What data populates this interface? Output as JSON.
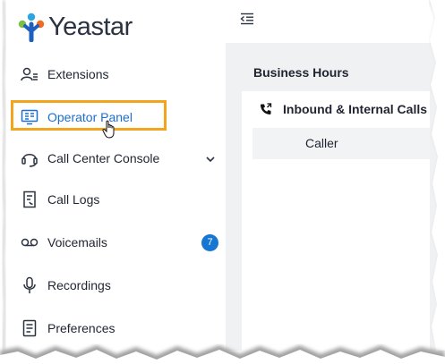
{
  "brand": {
    "name": "Yeastar",
    "logo_colors": [
      "#2aa7e1",
      "#f26b21",
      "#7bc142",
      "#1f5fbf"
    ]
  },
  "sidebar": {
    "items": [
      {
        "label": "Extensions",
        "icon": "extensions-icon"
      },
      {
        "label": "Operator Panel",
        "icon": "operator-panel-icon",
        "active": true
      },
      {
        "label": "Call Center Console",
        "icon": "headset-icon",
        "expandable": true
      },
      {
        "label": "Call Logs",
        "icon": "call-logs-icon"
      },
      {
        "label": "Voicemails",
        "icon": "voicemail-icon",
        "badge": "7"
      },
      {
        "label": "Recordings",
        "icon": "microphone-icon"
      },
      {
        "label": "Preferences",
        "icon": "preferences-icon"
      }
    ]
  },
  "main": {
    "section_title": "Business Hours",
    "card": {
      "header": "Inbound & Internal Calls",
      "column_label": "Caller"
    }
  },
  "colors": {
    "active": "#1c6fcc",
    "highlight": "#f2a51c",
    "badge": "#1677d2",
    "body_bg": "#f0f1f3"
  }
}
